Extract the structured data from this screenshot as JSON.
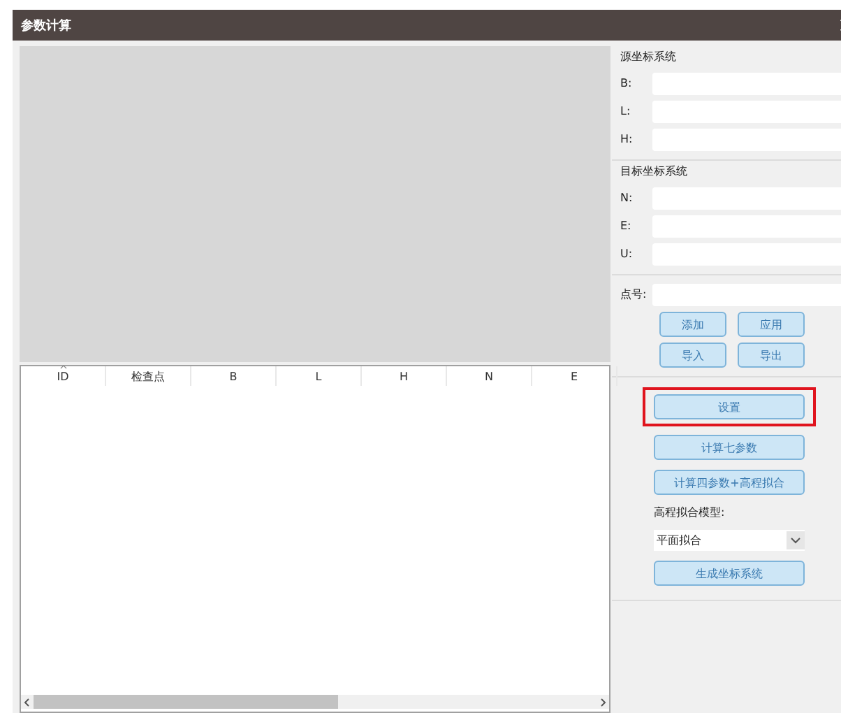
{
  "window": {
    "title": "参数计算"
  },
  "table": {
    "columns": [
      {
        "label": "ID",
        "sorted": true
      },
      {
        "label": "检查点",
        "sorted": false
      },
      {
        "label": "B",
        "sorted": false
      },
      {
        "label": "L",
        "sorted": false
      },
      {
        "label": "H",
        "sorted": false
      },
      {
        "label": "N",
        "sorted": false
      },
      {
        "label": "E",
        "sorted": false
      }
    ]
  },
  "source_system": {
    "title": "源坐标系统",
    "fields": [
      {
        "label": "B:"
      },
      {
        "label": "L:"
      },
      {
        "label": "H:"
      }
    ]
  },
  "target_system": {
    "title": "目标坐标系统",
    "fields": [
      {
        "label": "N:"
      },
      {
        "label": "E:"
      },
      {
        "label": "U:"
      }
    ]
  },
  "point": {
    "label": "点号:"
  },
  "point_buttons": [
    "添加",
    "应用",
    "导入",
    "导出"
  ],
  "actions": [
    {
      "label": "设置",
      "highlighted": true
    },
    {
      "label": "计算七参数",
      "highlighted": false
    },
    {
      "label": "计算四参数+高程拟合",
      "highlighted": false
    }
  ],
  "fit_model": {
    "label": "高程拟合模型:",
    "value": "平面拟合"
  },
  "generate_button": "生成坐标系统"
}
